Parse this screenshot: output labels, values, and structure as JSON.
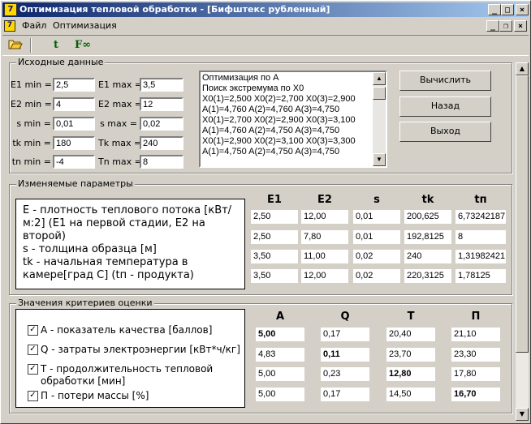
{
  "window": {
    "title": "Оптимизация тепловой обработки - [Бифштекс рубленный]"
  },
  "menu": {
    "file": "Файл",
    "optimize": "Оптимизация"
  },
  "toolbar": {
    "t_label": "t",
    "fopt_label": "F∞"
  },
  "input_group": {
    "title": "Исходные данные",
    "rows": [
      {
        "min_label": "E1 min =",
        "min_value": "2,5",
        "max_label": "E1 max =",
        "max_value": "3,5"
      },
      {
        "min_label": "E2 min =",
        "min_value": "4",
        "max_label": "E2 max =",
        "max_value": "12"
      },
      {
        "min_label": "s min =",
        "min_value": "0,01",
        "max_label": "s max =",
        "max_value": "0,02"
      },
      {
        "min_label": "tk min =",
        "min_value": "180",
        "max_label": "Tk max =",
        "max_value": "240"
      },
      {
        "min_label": "tn min =",
        "min_value": "-4",
        "max_label": "Tn max =",
        "max_value": "8"
      }
    ]
  },
  "log": {
    "lines": [
      "Оптимизация по A",
      "Поиск экстремума по X0",
      "X0(1)=2,500  X0(2)=2,700  X0(3)=2,900",
      "A(1)=4,760  A(2)=4,760  A(3)=4,750",
      "X0(1)=2,700  X0(2)=2,900  X0(3)=3,100",
      "A(1)=4,760  A(2)=4,750  A(3)=4,750",
      "X0(1)=2,900  X0(2)=3,100  X0(3)=3,300",
      "A(1)=4,750  A(2)=4,750  A(3)=4,750"
    ]
  },
  "buttons": {
    "compute": "Вычислить",
    "back": "Назад",
    "exit": "Выход"
  },
  "params": {
    "title": "Изменяемые параметры",
    "description": "E - плотность теплового потока [кВт/м:2] (E1 на первой стадии, E2 на второй)\ns - толщина образца [м]\ntk - начальная температура в камере[град С] (tп - продукта)",
    "headers": [
      "E1",
      "E2",
      "s",
      "tk",
      "tп"
    ],
    "rows": [
      [
        "2,50",
        "12,00",
        "0,01",
        "200,625",
        "6,73242187"
      ],
      [
        "2,50",
        "7,80",
        "0,01",
        "192,8125",
        "8"
      ],
      [
        "3,50",
        "11,00",
        "0,02",
        "240",
        "1,31982421"
      ],
      [
        "3,50",
        "12,00",
        "0,02",
        "220,3125",
        "1,78125"
      ]
    ]
  },
  "criteria": {
    "title": "Значения критериев оценки",
    "items": [
      {
        "check": "✓",
        "label": "A - показатель качества [баллов]"
      },
      {
        "check": "✓",
        "label": "Q - затраты электроэнергии [кВт*ч/кг]"
      },
      {
        "check": "✓",
        "label": "T - продолжительность тепловой обработки [мин]"
      },
      {
        "check": "✓",
        "label": "П - потери массы [%]"
      }
    ],
    "headers": [
      "A",
      "Q",
      "T",
      "П"
    ],
    "rows": [
      [
        "5,00",
        "0,17",
        "20,40",
        "21,10"
      ],
      [
        "4,83",
        "0,11",
        "23,70",
        "23,30"
      ],
      [
        "5,00",
        "0,23",
        "12,80",
        "17,80"
      ],
      [
        "5,00",
        "0,17",
        "14,50",
        "16,70"
      ]
    ]
  }
}
